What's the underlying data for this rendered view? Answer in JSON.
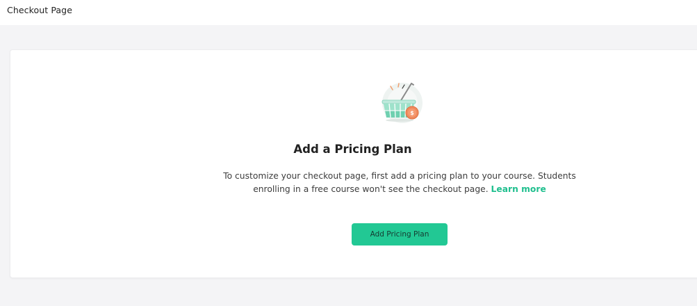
{
  "header": {
    "title": "Checkout Page"
  },
  "empty_state": {
    "illustration": "shopping-basket-with-coin-illustration",
    "heading": "Add a Pricing Plan",
    "description": "To customize your checkout page, first add a pricing plan to your course. Students enrolling in a free course won't see the checkout page.",
    "learn_more_label": "Learn more",
    "button_label": "Add Pricing Plan"
  },
  "colors": {
    "accent": "#22c894",
    "link": "#1fbf8e",
    "background": "#f4f4f6"
  }
}
